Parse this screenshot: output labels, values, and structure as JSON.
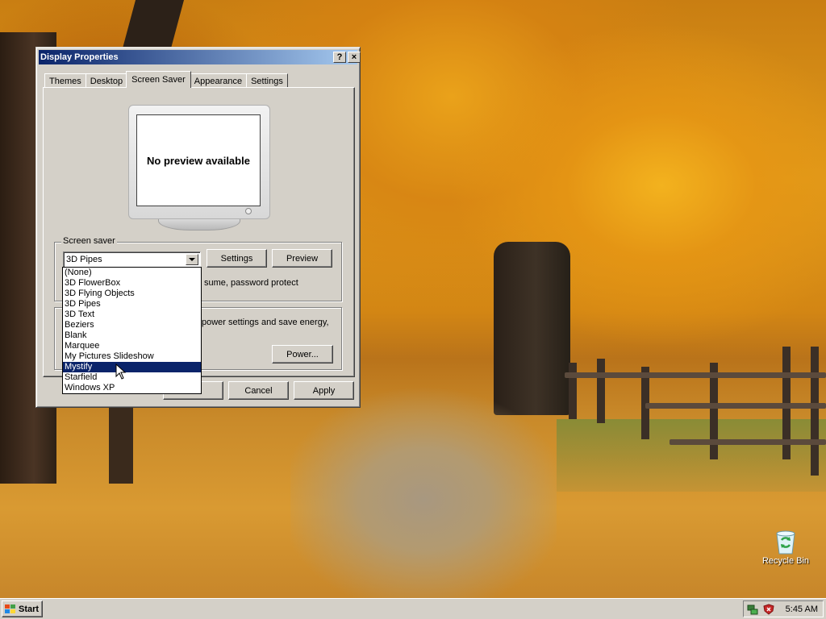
{
  "window": {
    "title": "Display Properties",
    "help_btn": "?",
    "close_btn": "×",
    "tabs": [
      {
        "label": "Themes",
        "active": false
      },
      {
        "label": "Desktop",
        "active": false
      },
      {
        "label": "Screen Saver",
        "active": true
      },
      {
        "label": "Appearance",
        "active": false
      },
      {
        "label": "Settings",
        "active": false
      }
    ],
    "preview_text": "No preview available",
    "screen_saver_group": {
      "label": "Screen saver",
      "selected": "3D Pipes",
      "settings_btn": "Settings",
      "preview_btn": "Preview",
      "partial_text": "sume, password protect"
    },
    "power_group": {
      "partial_text": "power settings and save energy,",
      "power_btn": "Power..."
    },
    "dialog_buttons": {
      "ok": "",
      "cancel": "Cancel",
      "apply": "Apply"
    },
    "dropdown_options": [
      "(None)",
      "3D FlowerBox",
      "3D Flying Objects",
      "3D Pipes",
      "3D Text",
      "Beziers",
      "Blank",
      "Marquee",
      "My Pictures Slideshow",
      "Mystify",
      "Starfield",
      "Windows XP"
    ],
    "highlighted_option": "Mystify"
  },
  "desktop": {
    "icons": [
      {
        "label": "Recycle Bin",
        "icon": "recycle-bin-icon"
      }
    ]
  },
  "taskbar": {
    "start_label": "Start",
    "clock": "5:45 AM",
    "tray_icons": [
      "network-icon",
      "security-shield-icon"
    ]
  },
  "colors": {
    "title_active": "#0a246a",
    "selection": "#0a246a",
    "face": "#d4d0c8"
  }
}
